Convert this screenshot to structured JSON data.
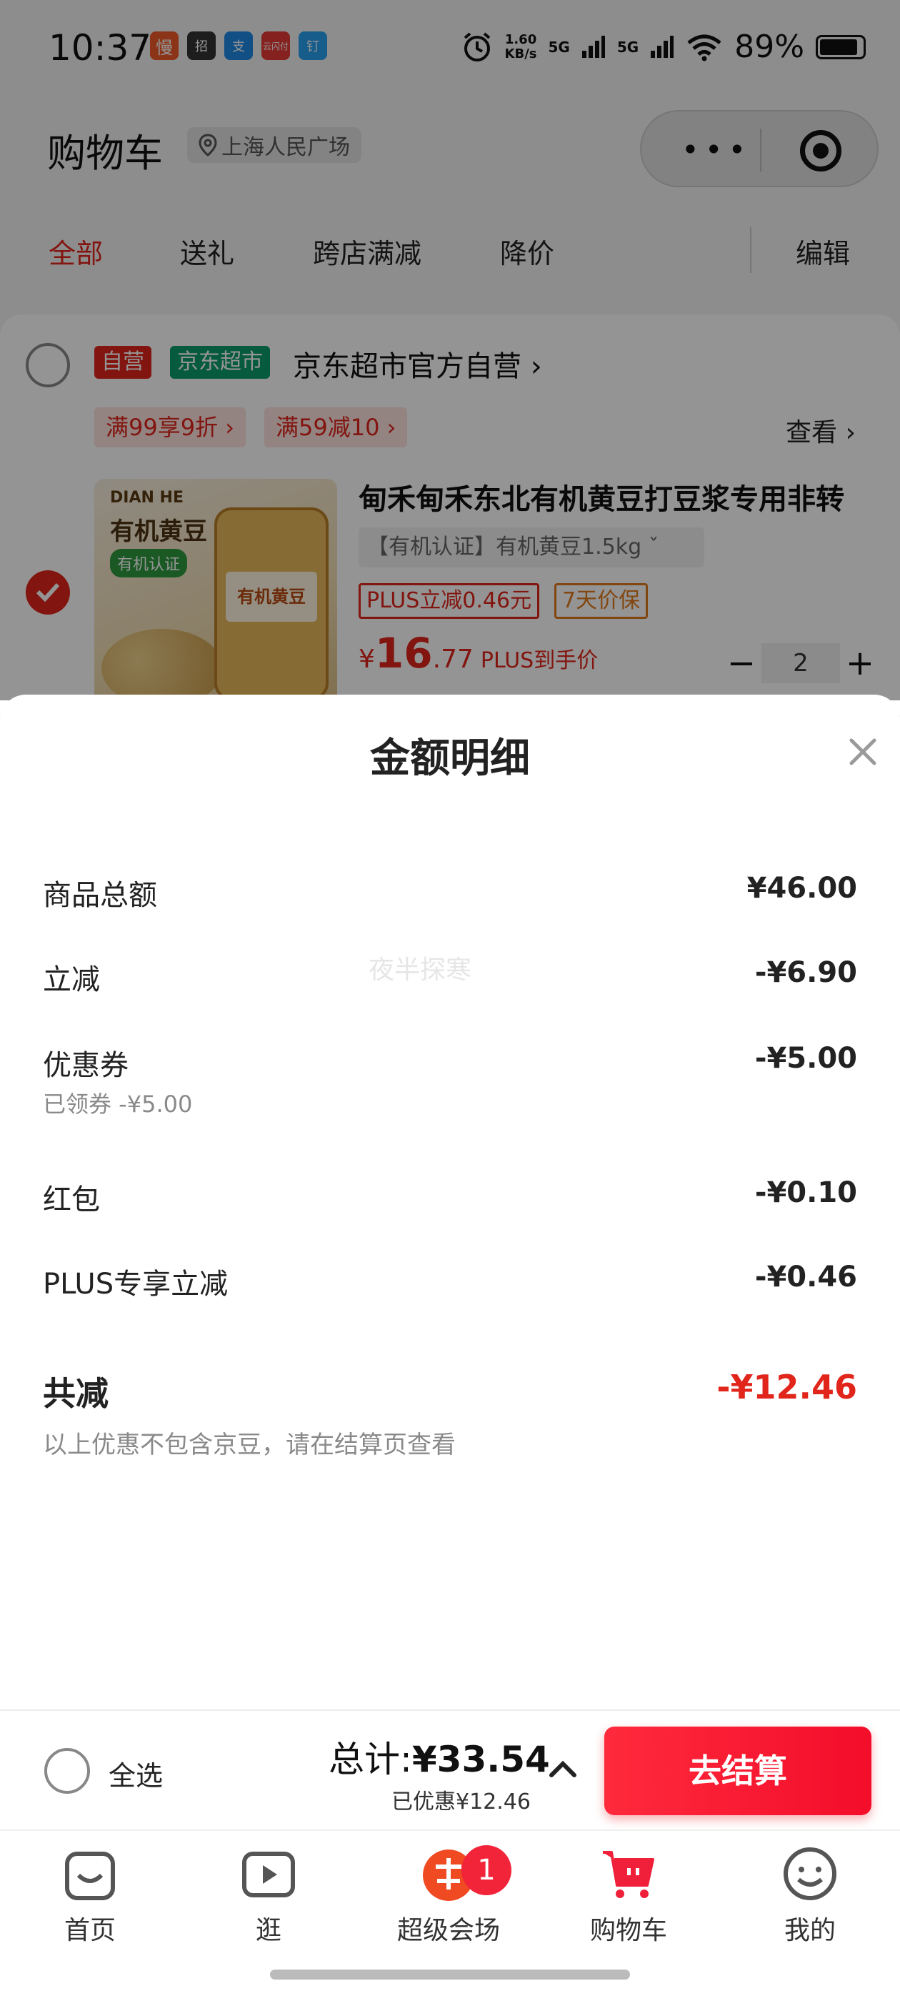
{
  "status_bar": {
    "time": "10:37",
    "network_speed_value": "1.60",
    "network_speed_unit": "KB/s",
    "signal1": "5G",
    "signal2": "5G",
    "battery": "89%",
    "app_icons": [
      "慢",
      "招",
      "支",
      "云闪付",
      "钉"
    ]
  },
  "header": {
    "title": "购物车",
    "location": "上海人民广场"
  },
  "tabs": [
    {
      "label": "全部",
      "active": true
    },
    {
      "label": "送礼",
      "active": false
    },
    {
      "label": "跨店满减",
      "active": false
    },
    {
      "label": "降价",
      "active": false
    }
  ],
  "edit_label": "编辑",
  "shop": {
    "tag_self": "自营",
    "tag_market": "京东超市",
    "name": "京东超市官方自营 ›",
    "promos": [
      "满99享9折 ›",
      "满59减10 ›"
    ],
    "see_label": "查看 ›"
  },
  "product": {
    "image_brand": "DIAN HE",
    "image_name": "有机黄豆",
    "image_cert": "有机认证",
    "image_jar_label": "有机黄豆",
    "title": "甸禾甸禾东北有机黄豆打豆浆专用非转",
    "spec": "【有机认证】有机黄豆1.5kg ˇ",
    "badge_plus": "PLUS立减0.46元",
    "badge_guarantee": "7天价保",
    "price_currency": "¥",
    "price_int": "16",
    "price_dec": ".77",
    "price_note": "PLUS到手价",
    "minus": "−",
    "quantity": "2",
    "plus": "+"
  },
  "sheet": {
    "title": "金额明细",
    "watermark": "夜半探寒",
    "rows": [
      {
        "label": "商品总额",
        "value": "¥46.00"
      },
      {
        "label": "立减",
        "value": "-¥6.90"
      },
      {
        "label": "优惠券",
        "value": "-¥5.00",
        "sub": "已领券 -¥5.00"
      },
      {
        "label": "红包",
        "value": "-¥0.10"
      },
      {
        "label": "PLUS专享立减",
        "value": "-¥0.46"
      }
    ],
    "total": {
      "label": "共减",
      "value": "-¥12.46",
      "note": "以上优惠不包含京豆，请在结算页查看"
    }
  },
  "checkout": {
    "select_all": "全选",
    "total_prefix": "总计:",
    "total_amount": "¥33.54",
    "discount": "已优惠¥12.46",
    "pay_button": "去结算"
  },
  "tabbar": {
    "items": [
      {
        "label": "首页",
        "active": false
      },
      {
        "label": "逛",
        "active": false
      },
      {
        "label": "超级会场",
        "active": false
      },
      {
        "label": "购物车",
        "active": true
      },
      {
        "label": "我的",
        "active": false
      }
    ],
    "badge": "1"
  },
  "colors": {
    "accent": "#e1251b",
    "jd_market": "#0c9b6a",
    "pay_button": "#f30d2a"
  }
}
